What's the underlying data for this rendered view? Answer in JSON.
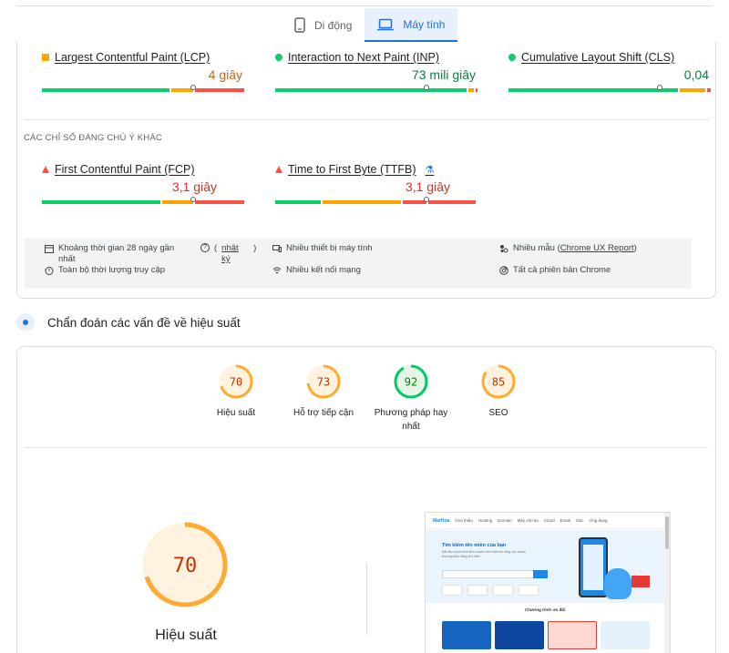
{
  "tabs": [
    {
      "label": "Di động",
      "icon": "phone-icon",
      "active": false
    },
    {
      "label": "Máy tính",
      "icon": "laptop-icon",
      "active": true
    }
  ],
  "core_metrics": [
    {
      "name": "Largest Contentful Paint (LCP)",
      "value": "4 giây",
      "status": "needs-improvement",
      "color": "#c5671b",
      "marker_fraction": 0.75
    },
    {
      "name": "Interaction to Next Paint (INP)",
      "value": "73 mili giây",
      "status": "good",
      "color": "#0d7c3f",
      "marker_fraction": 0.75
    },
    {
      "name": "Cumulative Layout Shift (CLS)",
      "value": "0,04",
      "status": "good",
      "color": "#0d7c3f",
      "marker_fraction": 0.75
    }
  ],
  "other_section_label": "CÁC CHỈ SỐ ĐÁNG CHÚ Ý KHÁC",
  "other_metrics": [
    {
      "name": "First Contentful Paint (FCP)",
      "value": "3,1 giây",
      "status": "poor",
      "color": "#d93025",
      "marker_fraction": 0.75,
      "experimental": false
    },
    {
      "name": "Time to First Byte (TTFB)",
      "value": "3,1 giây",
      "status": "poor",
      "color": "#d93025",
      "marker_fraction": 0.75,
      "experimental": true
    }
  ],
  "info": {
    "period": "Khoảng thời gian 28 ngày gần nhất",
    "history_link": "nhật ký",
    "duration": "Toàn bộ thời lượng truy cập",
    "devices": "Nhiều thiết bị máy tính",
    "network": "Nhiều kết nối mạng",
    "samples_prefix": "Nhiều mẫu (",
    "samples_link": "Chrome UX Report",
    "samples_suffix": ")",
    "chrome": "Tất cả phiên bản Chrome"
  },
  "diagnosis": {
    "title": "Chẩn đoán các vấn đề về hiệu suất"
  },
  "scores": [
    {
      "label": "Hiệu suất",
      "value": 70,
      "color": "#fa3",
      "text_color": "#c33300",
      "bg": "#fff3e0"
    },
    {
      "label": "Hỗ trợ tiếp cận",
      "value": 73,
      "color": "#fa3",
      "text_color": "#c33300",
      "bg": "#fff3e0"
    },
    {
      "label": "Phương pháp hay nhất",
      "value": 92,
      "color": "#0c6",
      "text_color": "#008800",
      "bg": "#e6f4ea"
    },
    {
      "label": "SEO",
      "value": 85,
      "color": "#fa3",
      "text_color": "#c33300",
      "bg": "#fff3e0"
    }
  ],
  "main_score": {
    "label": "Hiệu suất",
    "value": 70
  },
  "screenshot": {
    "logo": "MarHoa",
    "nav": [
      "Giới thiệu",
      "Hosting",
      "Domain",
      "Máy chủ ảo",
      "Cloud",
      "Email",
      "SSL",
      "Ứng dụng"
    ],
    "hero_title": "Tìm kiếm tên miền của bạn",
    "hero_text": "Bắt đầu hành trình kinh doanh trên internet, tăng sức mạnh thương hiệu bằng tên miền",
    "section_title": "Chương trình ưu đãi",
    "banners": [
      "#1565c0",
      "#0d47a1",
      "#ffffff",
      "#1e88e5"
    ]
  }
}
